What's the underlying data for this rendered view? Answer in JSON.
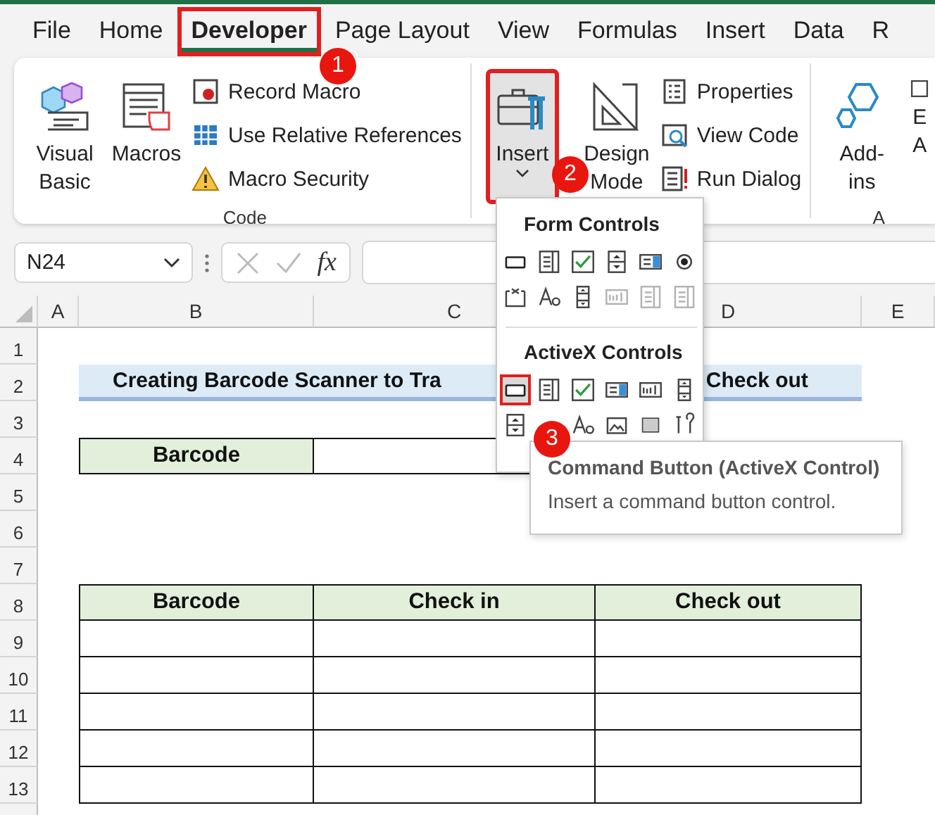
{
  "tabs": [
    {
      "label": "File",
      "selected": false,
      "highlighted": false
    },
    {
      "label": "Home",
      "selected": false,
      "highlighted": false
    },
    {
      "label": "Developer",
      "selected": true,
      "highlighted": true
    },
    {
      "label": "Page Layout",
      "selected": false,
      "highlighted": false
    },
    {
      "label": "View",
      "selected": false,
      "highlighted": false
    },
    {
      "label": "Formulas",
      "selected": false,
      "highlighted": false
    },
    {
      "label": "Insert",
      "selected": false,
      "highlighted": false
    },
    {
      "label": "Data",
      "selected": false,
      "highlighted": false
    },
    {
      "label": "R",
      "selected": false,
      "highlighted": false
    }
  ],
  "ribbon": {
    "groups": [
      {
        "label": "Code",
        "large_buttons": [
          {
            "lines": [
              "Visual",
              "Basic"
            ],
            "pressed": false,
            "highlighted": false
          },
          {
            "lines": [
              "Macros"
            ],
            "pressed": false,
            "highlighted": false
          }
        ],
        "small_buttons": [
          {
            "label": "Record Macro"
          },
          {
            "label": "Use Relative References"
          },
          {
            "label": "Macro Security"
          }
        ]
      },
      {
        "large_buttons": [
          {
            "lines": [
              "Insert"
            ],
            "pressed": true,
            "highlighted": true,
            "dropdown": true
          },
          {
            "lines": [
              "Design",
              "Mode"
            ],
            "pressed": false,
            "highlighted": false
          }
        ],
        "small_buttons": [
          {
            "label": "Properties"
          },
          {
            "label": "View Code"
          },
          {
            "label": "Run Dialog"
          }
        ]
      },
      {
        "label": "A",
        "large_buttons": [
          {
            "lines": [
              "Add-",
              "ins"
            ],
            "pressed": false,
            "highlighted": false
          },
          {
            "lines": [
              "E",
              "A"
            ],
            "pressed": false,
            "highlighted": false
          }
        ]
      }
    ]
  },
  "formula_bar": {
    "name_box": "N24",
    "function_label": "fx"
  },
  "columns": [
    "A",
    "B",
    "C",
    "D",
    "E"
  ],
  "rows": [
    {
      "number": "1",
      "kind": "plain"
    },
    {
      "number": "2",
      "kind": "title",
      "parts": [
        "Creating Barcode Scanner to Tra",
        "Check out"
      ]
    },
    {
      "number": "3",
      "kind": "plain"
    },
    {
      "number": "4",
      "kind": "input",
      "label": "Barcode"
    },
    {
      "number": "5",
      "kind": "plain"
    },
    {
      "number": "6",
      "kind": "plain"
    },
    {
      "number": "7",
      "kind": "plain"
    },
    {
      "number": "8",
      "kind": "table_header",
      "cells": [
        "Barcode",
        "Check in",
        "Check out"
      ]
    },
    {
      "number": "9",
      "kind": "table_row"
    },
    {
      "number": "10",
      "kind": "table_row"
    },
    {
      "number": "11",
      "kind": "table_row"
    },
    {
      "number": "12",
      "kind": "table_row"
    },
    {
      "number": "13",
      "kind": "table_row"
    }
  ],
  "insert_menu": {
    "sections": [
      {
        "title": "Form Controls",
        "controls": [
          {
            "kind": "button",
            "selected": false,
            "disabled": false
          },
          {
            "kind": "combo",
            "selected": false,
            "disabled": false
          },
          {
            "kind": "check",
            "selected": false,
            "disabled": false
          },
          {
            "kind": "spin",
            "selected": false,
            "disabled": false
          },
          {
            "kind": "listbox",
            "selected": false,
            "disabled": false
          },
          {
            "kind": "option",
            "selected": false,
            "disabled": false
          },
          {
            "kind": "group",
            "selected": false,
            "disabled": false
          },
          {
            "kind": "label",
            "selected": false,
            "disabled": false
          },
          {
            "kind": "scroll",
            "selected": false,
            "disabled": false
          },
          {
            "kind": "textbox",
            "selected": false,
            "disabled": true
          },
          {
            "kind": "combo",
            "selected": false,
            "disabled": true
          },
          {
            "kind": "combo",
            "selected": false,
            "disabled": true
          }
        ]
      },
      {
        "title": "ActiveX Controls",
        "controls": [
          {
            "kind": "button",
            "selected": true,
            "disabled": false
          },
          {
            "kind": "combo",
            "selected": false,
            "disabled": false
          },
          {
            "kind": "check",
            "selected": false,
            "disabled": false
          },
          {
            "kind": "listbox",
            "selected": false,
            "disabled": false
          },
          {
            "kind": "textbox",
            "selected": false,
            "disabled": false
          },
          {
            "kind": "scroll",
            "selected": false,
            "disabled": false
          },
          {
            "kind": "spin",
            "selected": false,
            "disabled": false
          },
          {
            "kind": "label",
            "selected": false,
            "disabled": false
          },
          {
            "kind": "image",
            "selected": false,
            "disabled": false
          },
          {
            "kind": "toggle",
            "selected": false,
            "disabled": false
          },
          {
            "kind": "tools",
            "selected": false,
            "disabled": false
          }
        ]
      }
    ]
  },
  "tooltip": {
    "title": "Command Button (ActiveX Control)",
    "description": "Insert a command button control."
  },
  "callouts": [
    "1",
    "2",
    "3"
  ]
}
